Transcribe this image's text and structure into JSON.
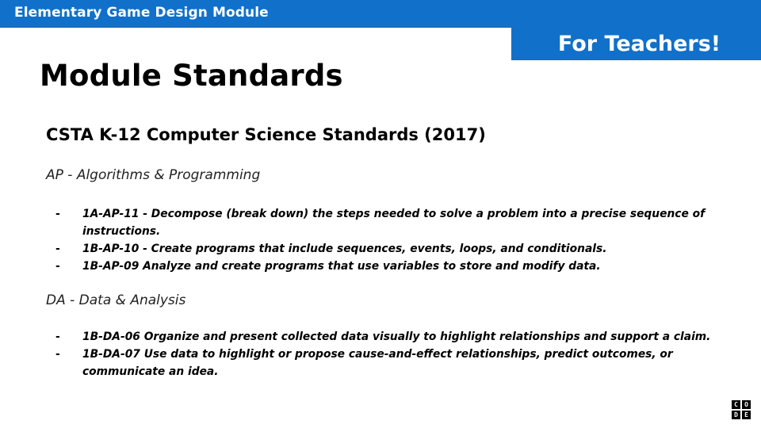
{
  "header": {
    "module_title": "Elementary Game Design Module",
    "audience_tab": "For Teachers!"
  },
  "page": {
    "title": "Module Standards",
    "standards_heading": "CSTA K-12 Computer Science Standards (2017)"
  },
  "sections": [
    {
      "label": "AP - Algorithms & Programming",
      "items": [
        "1A-AP-11 - Decompose (break down) the steps needed to solve a problem into a precise sequence of instructions.",
        "1B-AP-10 - Create programs that include sequences, events, loops, and conditionals.",
        "1B-AP-09 Analyze and create programs that use variables to store and modify data."
      ]
    },
    {
      "label": "DA - Data & Analysis",
      "items": [
        "1B-DA-06 Organize and present collected data visually to highlight relationships and support a claim.",
        "1B-DA-07 Use data to highlight or propose cause-and-effect relationships, predict outcomes, or communicate an idea."
      ]
    }
  ],
  "bullet": "-",
  "logo": {
    "letters": [
      "C",
      "O",
      "D",
      "E"
    ]
  },
  "colors": {
    "brand_blue": "#1170c9",
    "text": "#000000"
  }
}
